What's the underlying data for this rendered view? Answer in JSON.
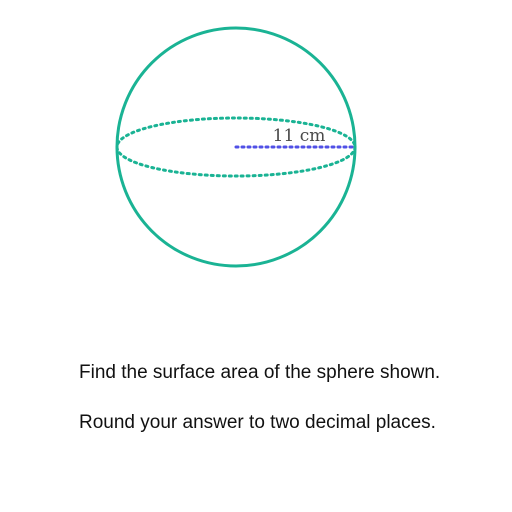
{
  "diagram": {
    "radius_label": "11 cm",
    "colors": {
      "sphere_outline": "#1ab394",
      "radius_line": "#5050e6",
      "label_text": "#4a4a4a"
    }
  },
  "question": {
    "prompt": "Find the surface area of the sphere shown.",
    "instruction": "Round your answer to two decimal places."
  }
}
